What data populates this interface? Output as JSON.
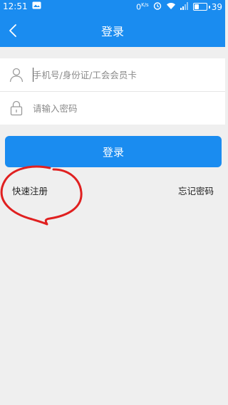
{
  "status_bar": {
    "time": "12:51",
    "net_speed": "0",
    "net_speed_unit": "K/s",
    "battery": "39",
    "battery_level": 0.39,
    "icons": [
      "gallery-notification-icon",
      "alarm-icon",
      "wifi-icon",
      "signal-icon",
      "battery-icon"
    ]
  },
  "header": {
    "title": "登录",
    "background": "#1a8cf0"
  },
  "form": {
    "account_placeholder": "手机号/身份证/工会会员卡",
    "password_placeholder": "请输入密码"
  },
  "actions": {
    "login_label": "登录",
    "register_label": "快速注册",
    "forgot_label": "忘记密码"
  },
  "colors": {
    "accent": "#1a8cf0",
    "background": "#efefef",
    "annotation": "#e02020"
  }
}
